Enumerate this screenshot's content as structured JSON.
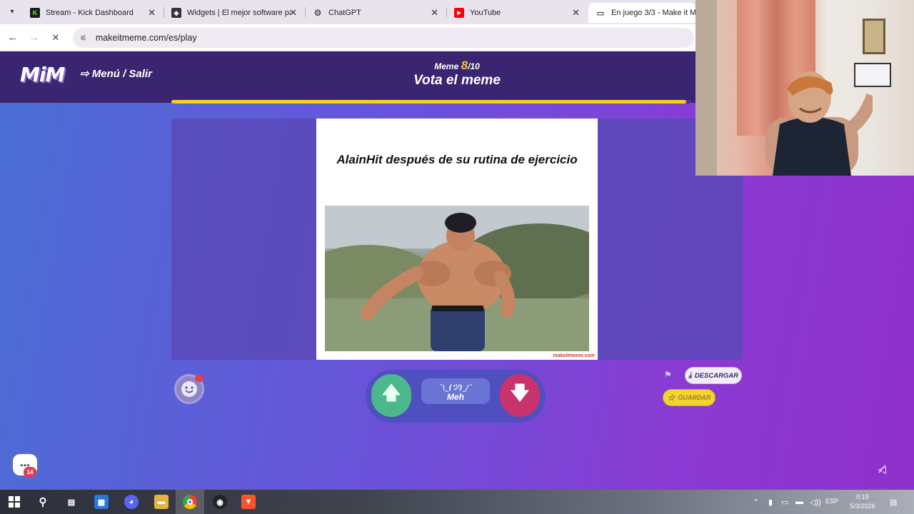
{
  "browser": {
    "tabs": [
      {
        "title": "Stream - Kick Dashboard",
        "icon": "kick-icon"
      },
      {
        "title": "Widgets | El mejor software par",
        "icon": "widgets-icon"
      },
      {
        "title": "ChatGPT",
        "icon": "chatgpt-icon"
      },
      {
        "title": "YouTube",
        "icon": "youtube-icon"
      },
      {
        "title": "En juego 3/3 - Make it Mem",
        "icon": "makeitmeme-icon"
      }
    ],
    "active_tab": 4,
    "url": "makeitmeme.com/es/play"
  },
  "header": {
    "logo": "MiM",
    "menu_exit_label": "Menú / Salir",
    "meme_label": "Meme",
    "meme_current": "8",
    "meme_total": "/10",
    "vote_title": "Vota el meme",
    "progress": 0.99
  },
  "meme": {
    "caption": "AlainHit después de su rutina de ejercicio",
    "image_alt": "muscular man running shirtless in beanie",
    "watermark": "makeitmeme.com"
  },
  "vote": {
    "meh_face": "¯\\_(ツ)_/¯",
    "meh_label": "Meh"
  },
  "actions": {
    "download_label": "DESCARGAR",
    "save_label": "GUARDAR"
  },
  "chat": {
    "badge_count": "14"
  },
  "taskbar": {
    "language": "ESP",
    "time": "0:19",
    "date": "5/3/2026"
  },
  "colors": {
    "accent_yellow": "#f4d21f",
    "upvote_green": "#4ab88c",
    "downvote_red": "#c8336d",
    "header_purple": "#3a2670"
  }
}
